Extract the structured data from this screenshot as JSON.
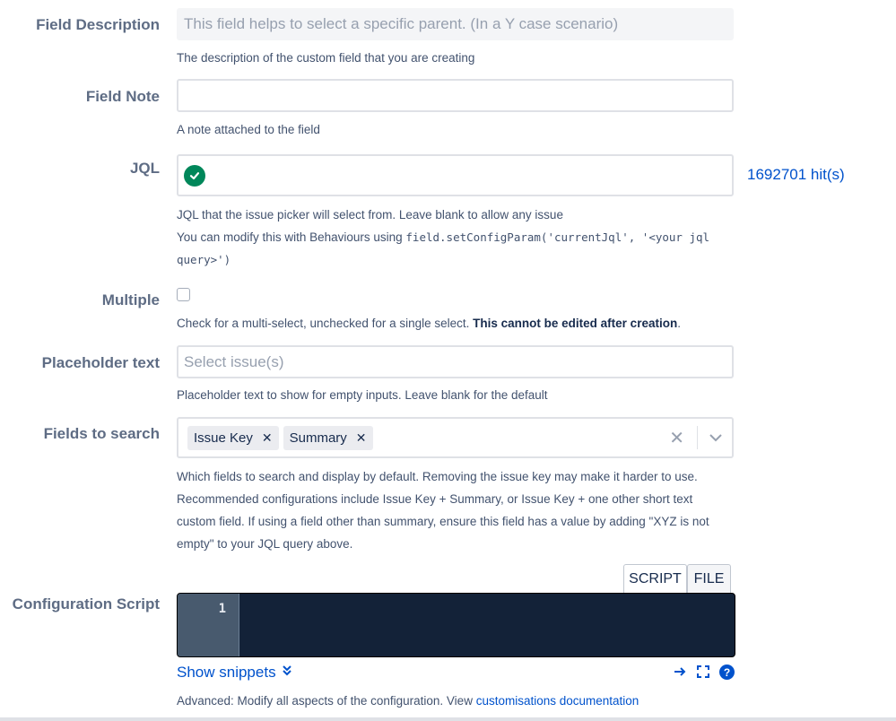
{
  "field_description": {
    "label": "Field Description",
    "value": "This field helps to select a specific parent. (In a Y case scenario)",
    "help": "The description of the custom field that you are creating"
  },
  "field_note": {
    "label": "Field Note",
    "value": "",
    "help": "A note attached to the field"
  },
  "jql": {
    "label": "JQL",
    "value": "",
    "hits": "1692701 hit(s)",
    "help1": "JQL that the issue picker will select from. Leave blank to allow any issue",
    "help2_prefix": "You can modify this with Behaviours using ",
    "help2_code_a": "field.setConfigParam('currentJql', '<your jql",
    "help2_code_b": "query>')"
  },
  "multiple": {
    "label": "Multiple",
    "checked": false,
    "help_plain": "Check for a multi-select, unchecked for a single select. ",
    "help_bold": "This cannot be edited after creation",
    "help_end": "."
  },
  "placeholder_text": {
    "label": "Placeholder text",
    "placeholder": "Select issue(s)",
    "help": "Placeholder text to show for empty inputs. Leave blank for the default"
  },
  "fields_to_search": {
    "label": "Fields to search",
    "chips": [
      "Issue Key",
      "Summary"
    ],
    "help": [
      "Which fields to search and display by default. Removing the issue key may make it harder to use.",
      "Recommended configurations include Issue Key + Summary, or Issue Key + one other short text",
      "custom field. If using a field other than summary, ensure this field has a value by adding \"XYZ is not",
      "empty\" to your JQL query above."
    ]
  },
  "configuration_script": {
    "label": "Configuration Script",
    "tabs": [
      "SCRIPT",
      "FILE"
    ],
    "line_number": "1",
    "show_snippets": "Show snippets",
    "help_prefix": "Advanced: Modify all aspects of the configuration. View ",
    "help_link": "customisations documentation"
  },
  "colors": {
    "accent": "#0052cc",
    "success": "#00875a",
    "editor_bg": "#132238",
    "gutter_bg": "#485a6e"
  }
}
